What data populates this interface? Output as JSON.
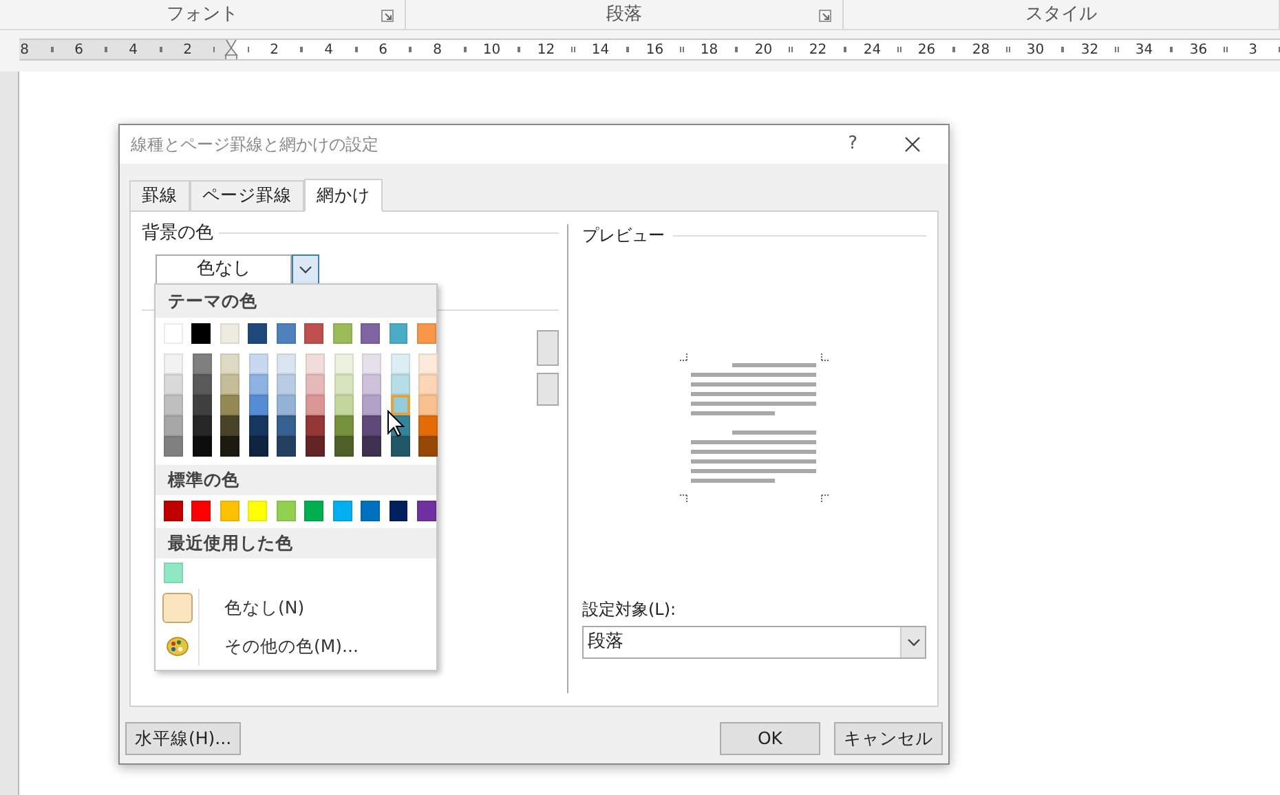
{
  "ribbon_groups": [
    {
      "label": "フォント",
      "launcher": true
    },
    {
      "label": "段落",
      "launcher": true
    },
    {
      "label": "スタイル",
      "launcher": false
    }
  ],
  "ruler": {
    "left_labels": [
      "8",
      "6",
      "4",
      "2"
    ],
    "right_labels": [
      "2",
      "4",
      "6",
      "8",
      "10",
      "12",
      "14",
      "16",
      "18",
      "20",
      "22",
      "24",
      "26",
      "28",
      "30",
      "32",
      "34",
      "36",
      "3"
    ]
  },
  "dialog": {
    "title": "線種とページ罫線と網かけの設定",
    "help": "?",
    "tabs": [
      {
        "label": "罫線",
        "selected": false
      },
      {
        "label": "ページ罫線",
        "selected": false
      },
      {
        "label": "網かけ",
        "selected": true
      }
    ],
    "fill_section": {
      "label": "背景の色",
      "select_value": "色なし"
    },
    "palette": {
      "theme_heading": "テーマの色",
      "theme_columns": [
        {
          "color": "#ffffff",
          "shades": [
            {
              "color": "#f2f2f2",
              "selected": false
            },
            {
              "color": "#d9d9d9",
              "selected": false
            },
            {
              "color": "#bfbfbf",
              "selected": false
            },
            {
              "color": "#a6a6a6",
              "selected": false
            },
            {
              "color": "#808080",
              "selected": false
            }
          ]
        },
        {
          "color": "#000000",
          "shades": [
            {
              "color": "#7f7f7f",
              "selected": false
            },
            {
              "color": "#595959",
              "selected": false
            },
            {
              "color": "#404040",
              "selected": false
            },
            {
              "color": "#262626",
              "selected": false
            },
            {
              "color": "#0d0d0d",
              "selected": false
            }
          ]
        },
        {
          "color": "#eeece1",
          "shades": [
            {
              "color": "#ddd9c3",
              "selected": false
            },
            {
              "color": "#c4bd97",
              "selected": false
            },
            {
              "color": "#938953",
              "selected": false
            },
            {
              "color": "#494429",
              "selected": false
            },
            {
              "color": "#1d1b10",
              "selected": false
            }
          ]
        },
        {
          "color": "#1f497d",
          "shades": [
            {
              "color": "#c6d9f0",
              "selected": false
            },
            {
              "color": "#8db3e2",
              "selected": false
            },
            {
              "color": "#548dd4",
              "selected": false
            },
            {
              "color": "#17365d",
              "selected": false
            },
            {
              "color": "#0f243e",
              "selected": false
            }
          ]
        },
        {
          "color": "#4f81bd",
          "shades": [
            {
              "color": "#dbe5f1",
              "selected": false
            },
            {
              "color": "#b8cce4",
              "selected": false
            },
            {
              "color": "#95b3d7",
              "selected": false
            },
            {
              "color": "#366092",
              "selected": false
            },
            {
              "color": "#244061",
              "selected": false
            }
          ]
        },
        {
          "color": "#c0504d",
          "shades": [
            {
              "color": "#f2dcdb",
              "selected": false
            },
            {
              "color": "#e5b9b7",
              "selected": false
            },
            {
              "color": "#d99694",
              "selected": false
            },
            {
              "color": "#953734",
              "selected": false
            },
            {
              "color": "#632423",
              "selected": false
            }
          ]
        },
        {
          "color": "#9bbb59",
          "shades": [
            {
              "color": "#ebf1dd",
              "selected": false
            },
            {
              "color": "#d7e3bc",
              "selected": false
            },
            {
              "color": "#c3d69b",
              "selected": false
            },
            {
              "color": "#76923c",
              "selected": false
            },
            {
              "color": "#4f6128",
              "selected": false
            }
          ]
        },
        {
          "color": "#8064a2",
          "shades": [
            {
              "color": "#e5e0ec",
              "selected": false
            },
            {
              "color": "#ccc1d9",
              "selected": false
            },
            {
              "color": "#b2a2c7",
              "selected": false
            },
            {
              "color": "#5f497a",
              "selected": false
            },
            {
              "color": "#3f3151",
              "selected": false
            }
          ]
        },
        {
          "color": "#4bacc6",
          "shades": [
            {
              "color": "#dbeef3",
              "selected": false
            },
            {
              "color": "#b7dde8",
              "selected": false
            },
            {
              "color": "#92cddc",
              "selected": true
            },
            {
              "color": "#31859b",
              "selected": false
            },
            {
              "color": "#205867",
              "selected": false
            }
          ]
        },
        {
          "color": "#f79646",
          "shades": [
            {
              "color": "#fdeada",
              "selected": false
            },
            {
              "color": "#fbd5b5",
              "selected": false
            },
            {
              "color": "#fac08f",
              "selected": false
            },
            {
              "color": "#e36c09",
              "selected": false
            },
            {
              "color": "#974806",
              "selected": false
            }
          ]
        }
      ],
      "standard_heading": "標準の色",
      "standard_colors": [
        {
          "color": "#c00000"
        },
        {
          "color": "#ff0000"
        },
        {
          "color": "#ffc000"
        },
        {
          "color": "#ffff00"
        },
        {
          "color": "#92d050"
        },
        {
          "color": "#00b050"
        },
        {
          "color": "#00b0f0"
        },
        {
          "color": "#0070c0"
        },
        {
          "color": "#002060"
        },
        {
          "color": "#7030a0"
        }
      ],
      "recent_heading": "最近使用した色",
      "recent_colors": [
        {
          "color": "#8ee8c4"
        }
      ],
      "items": [
        {
          "kind": "swatch",
          "label": "色なし(N)",
          "color": "#fbe5c0"
        },
        {
          "kind": "palette",
          "label": "その他の色(M)..."
        }
      ]
    },
    "preview": {
      "label": "プレビュー"
    },
    "apply_to": {
      "label": "設定対象(L):",
      "value": "段落"
    },
    "left_buttons": [
      "水平線(H)..."
    ],
    "right_buttons": [
      "OK",
      "キャンセル"
    ]
  }
}
